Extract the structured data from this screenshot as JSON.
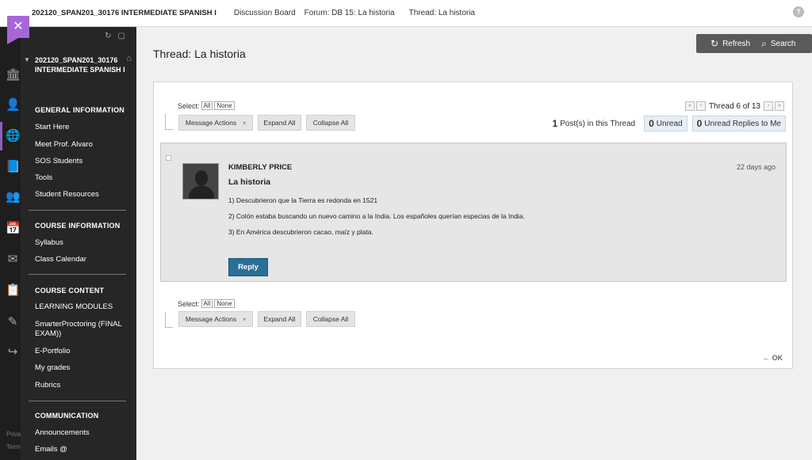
{
  "topbar": {
    "course": "202120_SPAN201_30176 INTERMEDIATE SPANISH I",
    "crumbs": [
      "Discussion Board",
      "Forum: DB 15: La historia",
      "Thread: La historia"
    ],
    "help": "?"
  },
  "rail": {
    "icons": [
      "institution-icon",
      "user-icon",
      "globe-icon",
      "courses-icon",
      "groups-icon",
      "calendar-icon",
      "messages-icon",
      "grades-icon",
      "tools-icon",
      "sign-out-icon"
    ],
    "footer": [
      "Priva",
      "Term"
    ]
  },
  "menu": {
    "course_title": "202120_SPAN201_30176 INTERMEDIATE SPANISH I",
    "sections": [
      {
        "title": "GENERAL INFORMATION",
        "items": [
          "Start Here",
          "Meet Prof. Alvaro",
          "SOS Students",
          "Tools",
          "Student Resources"
        ]
      },
      {
        "title": "COURSE INFORMATION",
        "items": [
          "Syllabus",
          "Class Calendar"
        ]
      },
      {
        "title": "COURSE CONTENT",
        "items": [
          "LEARNING MODULES",
          "SmarterProctoring (FINAL EXAM))",
          "E-Portfolio",
          "My grades",
          "Rubrics"
        ]
      },
      {
        "title": "COMMUNICATION",
        "items": [
          "Announcements",
          "Emails @"
        ]
      }
    ]
  },
  "page": {
    "title": "Thread: La historia",
    "refresh": "Refresh",
    "search": "Search"
  },
  "controls": {
    "select_label": "Select:",
    "all": "All",
    "none": "None",
    "message_actions": "Message Actions",
    "expand_all": "Expand All",
    "collapse_all": "Collapse All"
  },
  "pager": {
    "text": "Thread 6 of 13"
  },
  "counts": {
    "posts_num": "1",
    "posts_label": "Post(s) in this Thread",
    "unread_num": "0",
    "unread_label": "Unread",
    "unread_replies_num": "0",
    "unread_replies_label": "Unread Replies to Me"
  },
  "post": {
    "author": "KIMBERLY PRICE",
    "time": "22 days ago",
    "subject": "La historia",
    "lines": [
      "1) Descubrieron que la Tierra es redonda en 1521",
      "2) Colón estaba buscando un nuevo camino a la India. Los españoles querían especias de la India.",
      "3) En América descubrieron cacao, maíz y plata."
    ],
    "reply": "Reply"
  },
  "footer": {
    "ok": "← OK"
  }
}
